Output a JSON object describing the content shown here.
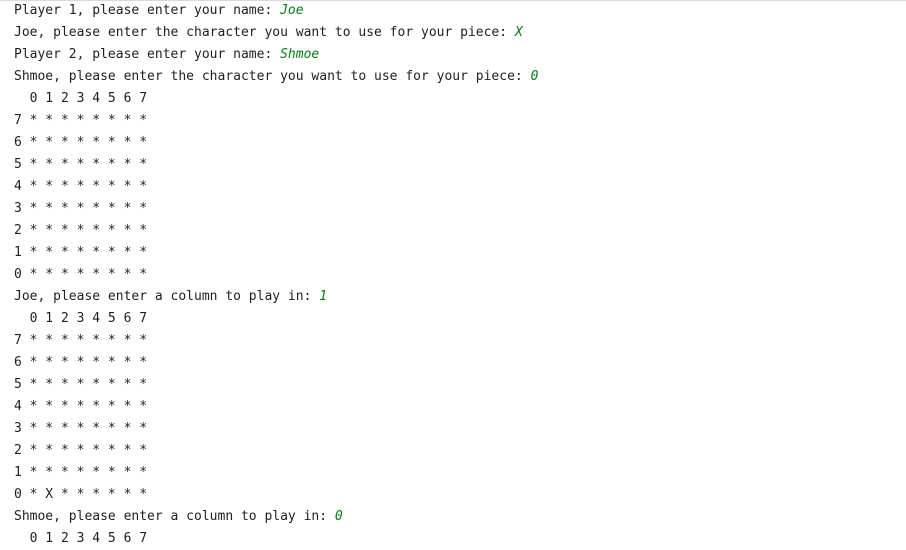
{
  "console": {
    "lines": [
      {
        "text": "Player 1, please enter your name: ",
        "input": "Joe"
      },
      {
        "text": "Joe, please enter the character you want to use for your piece: ",
        "input": "X"
      },
      {
        "text": "Player 2, please enter your name: ",
        "input": "Shmoe"
      },
      {
        "text": "Shmoe, please enter the character you want to use for your piece: ",
        "input": "0"
      },
      {
        "text": "  0 1 2 3 4 5 6 7"
      },
      {
        "text": "7 * * * * * * * *"
      },
      {
        "text": "6 * * * * * * * *"
      },
      {
        "text": "5 * * * * * * * *"
      },
      {
        "text": "4 * * * * * * * *"
      },
      {
        "text": "3 * * * * * * * *"
      },
      {
        "text": "2 * * * * * * * *"
      },
      {
        "text": "1 * * * * * * * *"
      },
      {
        "text": "0 * * * * * * * *"
      },
      {
        "text": "Joe, please enter a column to play in: ",
        "input": "1"
      },
      {
        "text": "  0 1 2 3 4 5 6 7"
      },
      {
        "text": "7 * * * * * * * *"
      },
      {
        "text": "6 * * * * * * * *"
      },
      {
        "text": "5 * * * * * * * *"
      },
      {
        "text": "4 * * * * * * * *"
      },
      {
        "text": "3 * * * * * * * *"
      },
      {
        "text": "2 * * * * * * * *"
      },
      {
        "text": "1 * * * * * * * *"
      },
      {
        "text": "0 * X * * * * * *"
      },
      {
        "text": "Shmoe, please enter a column to play in: ",
        "input": "0"
      },
      {
        "text": "  0 1 2 3 4 5 6 7"
      }
    ]
  }
}
